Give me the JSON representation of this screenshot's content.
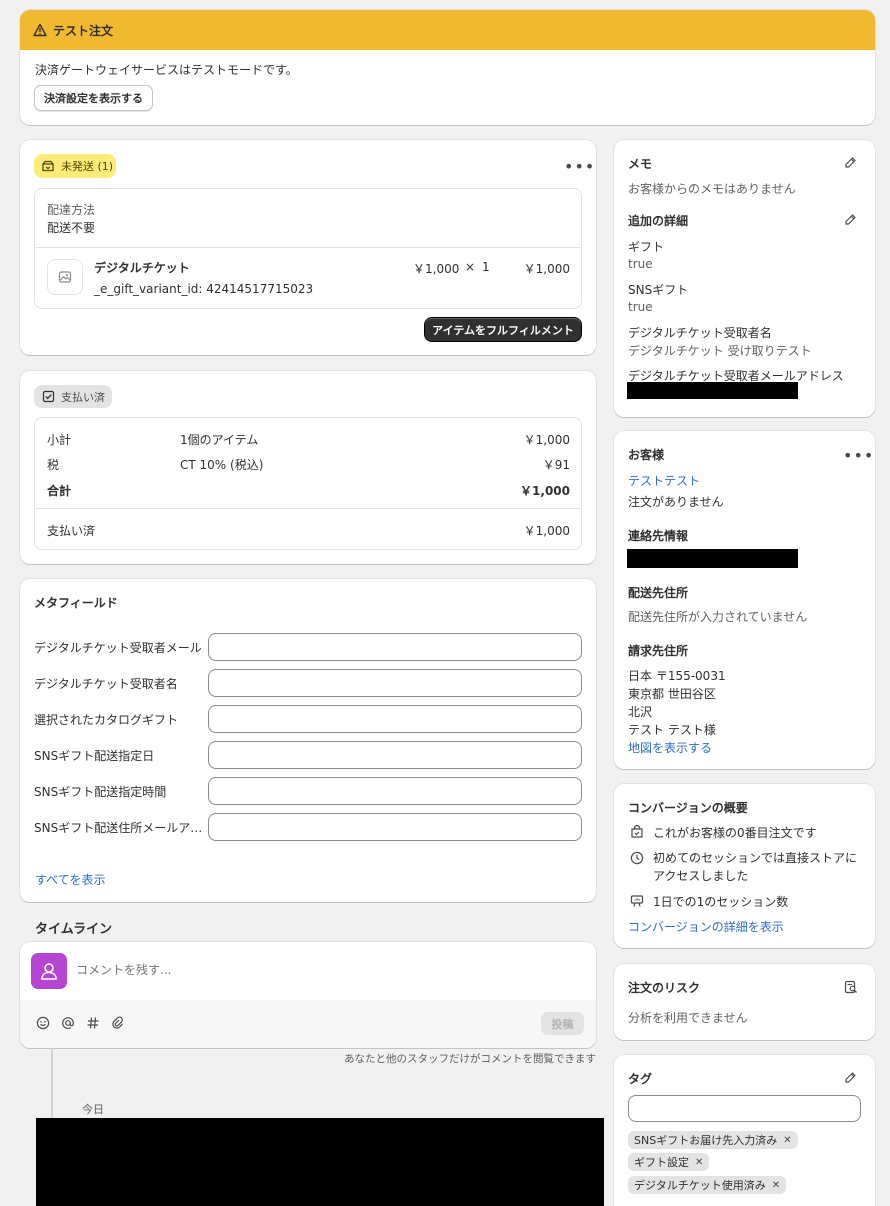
{
  "banner": {
    "title": "テスト注文",
    "message": "決済ゲートウェイサービスはテストモードです。",
    "button": "決済設定を表示する",
    "color": "#f0b92f"
  },
  "fulfillment": {
    "badge": "未発送 (1)",
    "shipping_label": "配達方法",
    "shipping_value": "配送不要",
    "item_name": "デジタルチケット",
    "item_variant": "_e_gift_variant_id: 42414517715023",
    "unit_price": "￥1,000",
    "times": "×",
    "quantity": "1",
    "line_total": "￥1,000",
    "button": "アイテムをフルフィルメント"
  },
  "payment": {
    "badge": "支払い済",
    "rows": [
      {
        "label": "小計",
        "desc": "1個のアイテム",
        "amount": "￥1,000"
      },
      {
        "label": "税",
        "desc": "CT 10% (税込)",
        "amount": "￥91"
      },
      {
        "label": "合計",
        "desc": "",
        "amount": "￥1,000"
      }
    ],
    "paid_label": "支払い済",
    "paid_amount": "￥1,000"
  },
  "metafields": {
    "title": "メタフィールド",
    "fields": [
      {
        "label": "デジタルチケット受取者メール",
        "value": ""
      },
      {
        "label": "デジタルチケット受取者名",
        "value": ""
      },
      {
        "label": "選択されたカタログギフト",
        "value": ""
      },
      {
        "label": "SNSギフト配送指定日",
        "value": ""
      },
      {
        "label": "SNSギフト配送指定時間",
        "value": ""
      },
      {
        "label": "SNSギフト配送住所メールア…",
        "value": ""
      }
    ],
    "show_all": "すべてを表示"
  },
  "timeline": {
    "title": "タイムライン",
    "comment_placeholder": "コメントを残す...",
    "post_button": "投稿",
    "note": "あなたと他のスタッフだけがコメントを閲覧できます",
    "date_label": "今日"
  },
  "memo": {
    "title": "メモ",
    "text": "お客様からのメモはありません"
  },
  "additional": {
    "title": "追加の詳細",
    "items": [
      {
        "label": "ギフト",
        "value": "true"
      },
      {
        "label": "SNSギフト",
        "value": "true"
      },
      {
        "label": "デジタルチケット受取者名",
        "value": "デジタルチケット 受け取りテスト"
      },
      {
        "label": "デジタルチケット受取者メールアドレス",
        "value": ""
      }
    ]
  },
  "customer": {
    "title": "お客様",
    "name": "テストテスト",
    "orders": "注文がありません",
    "contact_title": "連絡先情報",
    "shipping_title": "配送先住所",
    "shipping_text": "配送先住所が入力されていません",
    "billing_title": "請求先住所",
    "billing_lines": [
      "日本 〒155-0031",
      "東京都 世田谷区",
      "北沢",
      "テスト テスト様"
    ],
    "map_link": "地図を表示する"
  },
  "conversion": {
    "title": "コンバージョンの概要",
    "items": [
      {
        "icon": "orders-icon",
        "text": "これがお客様の0番目注文です"
      },
      {
        "icon": "session-icon",
        "text": "初めてのセッションでは直接ストアにアクセスしました"
      },
      {
        "icon": "visits-icon",
        "text": "1日での1のセッション数"
      }
    ],
    "link": "コンバージョンの詳細を表示"
  },
  "risk": {
    "title": "注文のリスク",
    "text": "分析を利用できません"
  },
  "tags": {
    "title": "タグ",
    "input_value": "",
    "items": [
      "SNSギフトお届け先入力済み",
      "ギフト設定",
      "デジタルチケット使用済み"
    ]
  }
}
